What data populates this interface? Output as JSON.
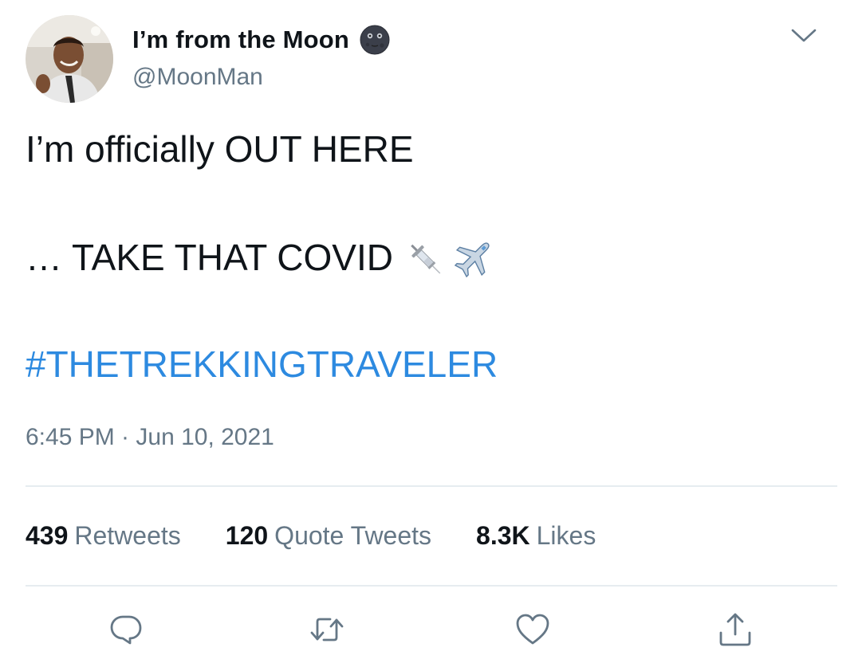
{
  "author": {
    "display_name": "I’m from the Moon",
    "handle": "@MoonMan",
    "name_badge_icon": "new-moon-face-emoji",
    "avatar_icon": "profile-photo"
  },
  "tweet": {
    "line1": "I’m officially OUT HERE",
    "line2": "… TAKE THAT COVID",
    "line2_emojis": [
      "syringe-emoji",
      "airplane-emoji"
    ],
    "hashtag": "#THETREKKINGTRAVELER",
    "timestamp": "6:45 PM · Jun 10, 2021"
  },
  "stats": {
    "retweets_count": "439",
    "retweets_label": "Retweets",
    "quotes_count": "120",
    "quotes_label": "Quote Tweets",
    "likes_count": "8.3K",
    "likes_label": "Likes"
  },
  "actions": [
    "reply-icon",
    "retweet-icon",
    "like-icon",
    "share-icon"
  ],
  "colors": {
    "text": "#0f1419",
    "secondary": "#657786",
    "link": "#2d8ae0",
    "divider": "#e6ecf0"
  }
}
